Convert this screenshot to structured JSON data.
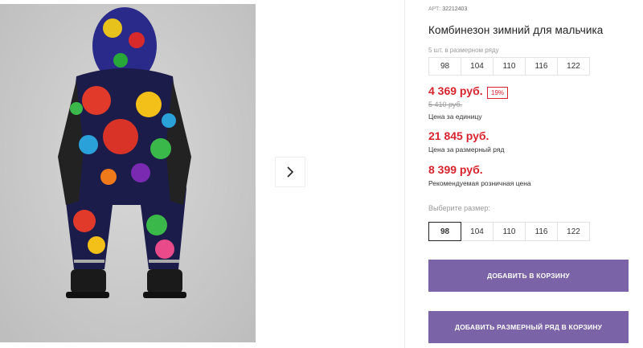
{
  "gallery": {
    "photo_alt": "Комбинезон зимний для мальчика",
    "next_icon": "chevron-right-icon"
  },
  "product": {
    "article_label": "АРТ:",
    "article_value": "32212403",
    "title": "Комбинезон зимний для мальчика",
    "row_note": "5 шт. в размерном ряду",
    "row_sizes": [
      "98",
      "104",
      "110",
      "116",
      "122"
    ],
    "unit_price": "4 369 руб.",
    "discount": "19%",
    "old_price": "5 410 руб.",
    "unit_price_label": "Цена за единицу",
    "row_price": "21 845 руб.",
    "row_price_label": "Цена за размерный ряд",
    "retail_price": "8 399 руб.",
    "retail_price_label": "Рекомендуемая розничная цена",
    "choose_size_label": "Выберите размер:",
    "sizes": [
      "98",
      "104",
      "110",
      "116",
      "122"
    ],
    "selected_size": "98"
  },
  "actions": {
    "add_to_cart": "ДОБАВИТЬ В КОРЗИНУ",
    "add_row_to_cart": "ДОБАВИТЬ РАЗМЕРНЫЙ РЯД В КОРЗИНУ"
  },
  "colors": {
    "price_red": "#d7232e",
    "button_purple": "#7b63a8"
  }
}
